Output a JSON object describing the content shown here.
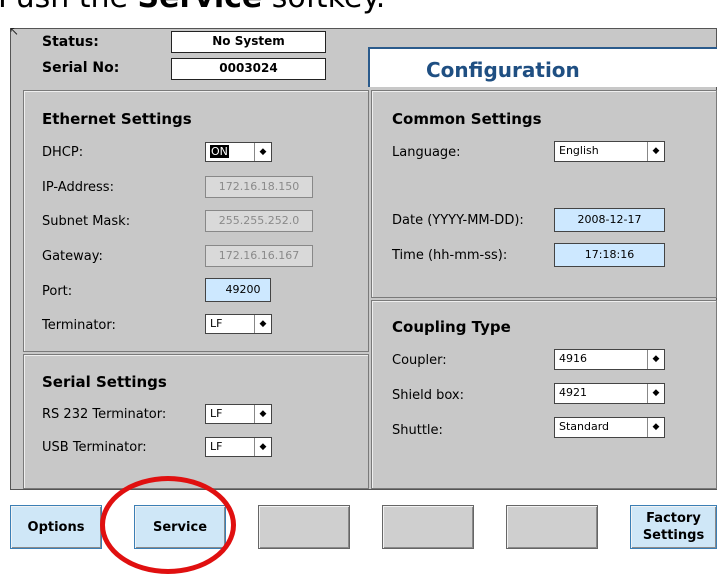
{
  "instruction": {
    "prefix": "Push the ",
    "key_word": "Service",
    "suffix": " softkey."
  },
  "header": {
    "status_label": "Status:",
    "status_value": "No System",
    "serial_label": "Serial No:",
    "serial_value": "0003024",
    "screen_title": "Configuration"
  },
  "ethernet": {
    "title": "Ethernet Settings",
    "dhcp_label": "DHCP:",
    "dhcp_value": "ON",
    "ip_label": "IP-Address:",
    "ip_value": "172.16.18.150",
    "subnet_label": "Subnet Mask:",
    "subnet_value": "255.255.252.0",
    "gateway_label": "Gateway:",
    "gateway_value": "172.16.16.167",
    "port_label": "Port:",
    "port_value": "49200",
    "terminator_label": "Terminator:",
    "terminator_value": "LF"
  },
  "serial": {
    "title": "Serial Settings",
    "rs232_label": "RS 232 Terminator:",
    "rs232_value": "LF",
    "usb_label": "USB Terminator:",
    "usb_value": "LF"
  },
  "common": {
    "title": "Common Settings",
    "language_label": "Language:",
    "language_value": "English",
    "date_label": "Date (YYYY-MM-DD):",
    "date_value": "2008-12-17",
    "time_label": "Time (hh-mm-ss):",
    "time_value": "17:18:16"
  },
  "coupling": {
    "title": "Coupling Type",
    "coupler_label": "Coupler:",
    "coupler_value": "4916",
    "shield_label": "Shield box:",
    "shield_value": "4921",
    "shuttle_label": "Shuttle:",
    "shuttle_value": "Standard"
  },
  "softkeys": {
    "options": "Options",
    "service": "Service",
    "factory_line1": "Factory",
    "factory_line2": "Settings"
  },
  "icons": {
    "dropdown": "dropdown-arrow-icon"
  },
  "colors": {
    "title_blue": "#1f4f82",
    "input_blue": "#cde8ff",
    "highlight_circle": "#e01010"
  }
}
